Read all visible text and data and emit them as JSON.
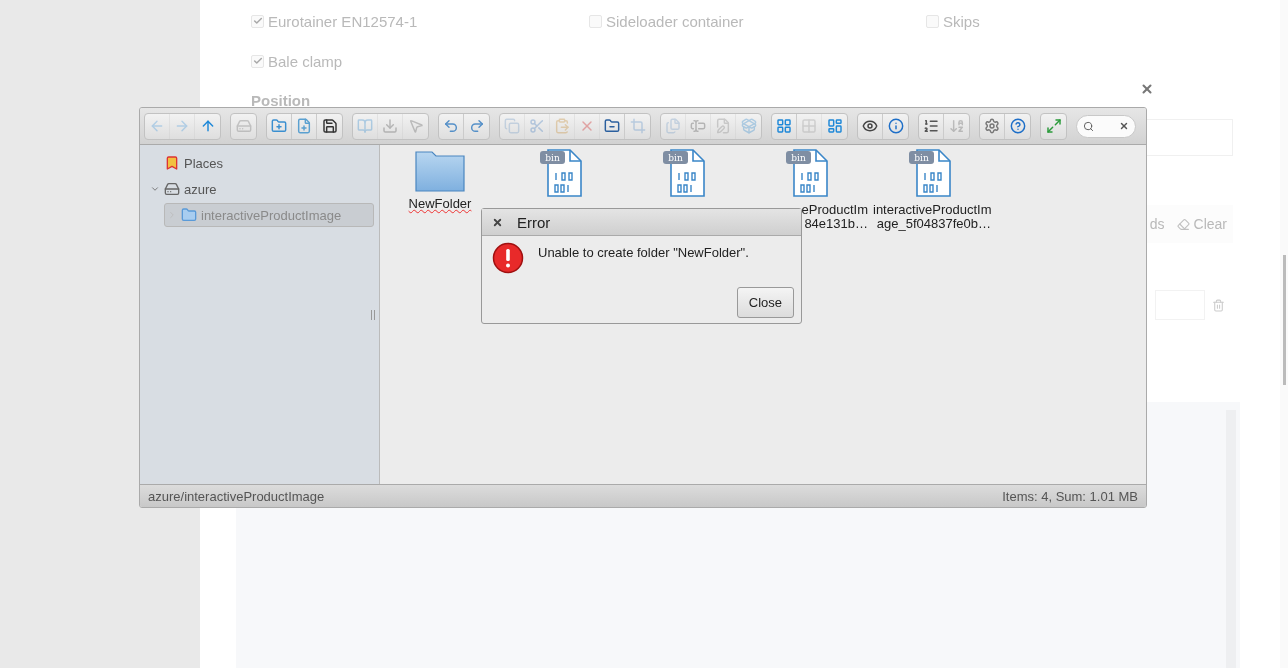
{
  "page": {
    "options": [
      {
        "label": "Eurotainer EN12574-1",
        "checked": true
      },
      {
        "label": "Sideloader container",
        "checked": false
      },
      {
        "label": "Skips",
        "checked": false
      },
      {
        "label": "Bale clamp",
        "checked": true
      }
    ],
    "section_title": "Position",
    "buttons": [
      "ds",
      "Clear"
    ]
  },
  "file_manager": {
    "toolbar": [
      [
        {
          "kind": "back",
          "disabled": true
        },
        {
          "kind": "forward",
          "disabled": true
        },
        {
          "kind": "up",
          "disabled": false
        }
      ],
      [
        {
          "kind": "netmount",
          "disabled": true
        }
      ],
      [
        {
          "kind": "mkdir",
          "disabled": false
        },
        {
          "kind": "mkfile",
          "disabled": false
        },
        {
          "kind": "upload",
          "disabled": false
        }
      ],
      [
        {
          "kind": "open",
          "disabled": true
        },
        {
          "kind": "download",
          "disabled": true
        },
        {
          "kind": "select",
          "disabled": true
        }
      ],
      [
        {
          "kind": "undo",
          "disabled": false
        },
        {
          "kind": "redo",
          "disabled": false
        }
      ],
      [
        {
          "kind": "copy",
          "disabled": true
        },
        {
          "kind": "cut",
          "disabled": true
        },
        {
          "kind": "paste",
          "disabled": true
        },
        {
          "kind": "delete",
          "disabled": true
        },
        {
          "kind": "empty",
          "disabled": false
        },
        {
          "kind": "resize",
          "disabled": true
        }
      ],
      [
        {
          "kind": "duplicate",
          "disabled": true
        },
        {
          "kind": "rename",
          "disabled": true
        },
        {
          "kind": "edit",
          "disabled": true
        },
        {
          "kind": "extract",
          "disabled": true
        }
      ],
      [
        {
          "kind": "view_icons",
          "disabled": false
        },
        {
          "kind": "view_grid",
          "disabled": true
        },
        {
          "kind": "view_mixed",
          "disabled": false
        }
      ],
      [
        {
          "kind": "preview",
          "disabled": false
        },
        {
          "kind": "info",
          "disabled": false
        }
      ],
      [
        {
          "kind": "sort",
          "disabled": false
        },
        {
          "kind": "sort_az",
          "disabled": true
        }
      ],
      [
        {
          "kind": "settings",
          "disabled": false
        },
        {
          "kind": "help",
          "disabled": false
        }
      ],
      [
        {
          "kind": "fullscreen",
          "disabled": false
        }
      ]
    ],
    "tree": [
      {
        "kind": "places",
        "label": "Places",
        "selected": false
      },
      {
        "kind": "volume",
        "label": "azure",
        "selected": false,
        "expanded": true,
        "children": [
          {
            "kind": "folder",
            "label": "interactiveProductImage",
            "selected": true,
            "expanded": false
          }
        ]
      }
    ],
    "files": [
      {
        "kind": "folder",
        "name": "NewFolder",
        "editing": true
      },
      {
        "kind": "binary",
        "badge": "bin"
      },
      {
        "kind": "binary",
        "badge": "bin"
      },
      {
        "kind": "binary",
        "badge": "bin",
        "name": "eProductIm\n84e131b…"
      },
      {
        "kind": "binary",
        "badge": "bin",
        "name": "interactiveProductIm\nage_5f04837fe0b…"
      }
    ],
    "status_bar": {
      "path": "azure/interactiveProductImage",
      "summary": "Items: 4, Sum: 1.01 MB"
    },
    "dialog": {
      "title": "Error",
      "message": "Unable to create folder \"NewFolder\".",
      "buttons": [
        "Close"
      ]
    }
  }
}
